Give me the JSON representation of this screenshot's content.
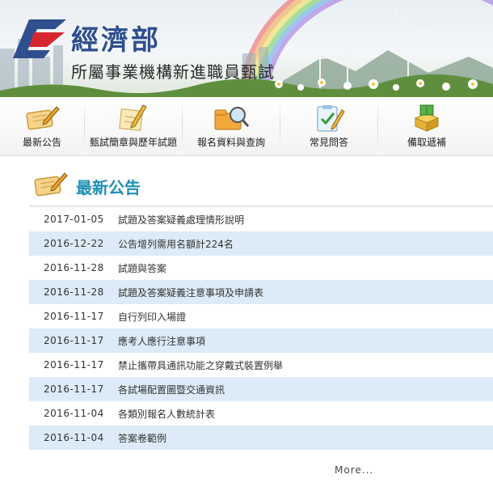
{
  "header": {
    "ministry": "經濟部",
    "subtitle": "所屬事業機構新進職員甄試"
  },
  "nav": {
    "items": [
      {
        "label": "最新公告",
        "icon": "notepad-pencil-icon"
      },
      {
        "label": "甄試簡章與歷年試題",
        "icon": "paper-pen-icon"
      },
      {
        "label": "報名資料與查詢",
        "icon": "magnifier-folder-icon"
      },
      {
        "label": "常見問答",
        "icon": "clipboard-check-icon"
      },
      {
        "label": "備取遞補",
        "icon": "stacked-box-icon"
      }
    ]
  },
  "section": {
    "title": "最新公告",
    "icon": "notepad-pencil-icon"
  },
  "announcements": [
    {
      "date": "2017-01-05",
      "title": "試題及答案疑義處理情形說明"
    },
    {
      "date": "2016-12-22",
      "title": "公告增列需用名額計224名"
    },
    {
      "date": "2016-11-28",
      "title": "試題與答案"
    },
    {
      "date": "2016-11-28",
      "title": "試題及答案疑義注意事項及申請表"
    },
    {
      "date": "2016-11-17",
      "title": "自行列印入場證"
    },
    {
      "date": "2016-11-17",
      "title": "應考人應行注意事項"
    },
    {
      "date": "2016-11-17",
      "title": "禁止攜帶具通訊功能之穿戴式裝置例舉"
    },
    {
      "date": "2016-11-17",
      "title": "各試場配置圖暨交通資訊"
    },
    {
      "date": "2016-11-04",
      "title": "各類別報名人數統計表"
    },
    {
      "date": "2016-11-04",
      "title": "答案卷範例"
    }
  ],
  "more_label": "More...",
  "colors": {
    "accent": "#1f8fb5",
    "row_alt": "#dcebf7",
    "brand_red": "#d6272f",
    "brand_blue": "#2f4f8f"
  }
}
